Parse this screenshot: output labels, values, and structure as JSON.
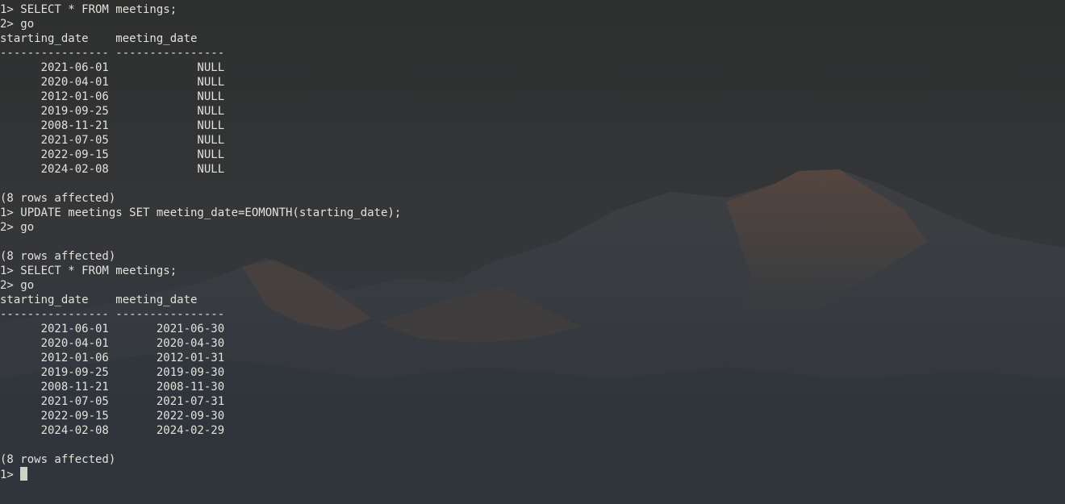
{
  "terminal": {
    "lines": [
      "1> SELECT * FROM meetings;",
      "2> go",
      "starting_date    meeting_date",
      "---------------- ----------------",
      "      2021-06-01             NULL",
      "      2020-04-01             NULL",
      "      2012-01-06             NULL",
      "      2019-09-25             NULL",
      "      2008-11-21             NULL",
      "      2021-07-05             NULL",
      "      2022-09-15             NULL",
      "      2024-02-08             NULL",
      "",
      "(8 rows affected)",
      "1> UPDATE meetings SET meeting_date=EOMONTH(starting_date);",
      "2> go",
      "",
      "(8 rows affected)",
      "1> SELECT * FROM meetings;",
      "2> go",
      "starting_date    meeting_date",
      "---------------- ----------------",
      "      2021-06-01       2021-06-30",
      "      2020-04-01       2020-04-30",
      "      2012-01-06       2012-01-31",
      "      2019-09-25       2019-09-30",
      "      2008-11-21       2008-11-30",
      "      2021-07-05       2021-07-31",
      "      2022-09-15       2022-09-30",
      "      2024-02-08       2024-02-29",
      "",
      "(8 rows affected)"
    ],
    "prompt": "1> "
  },
  "colors": {
    "text": "#e2e2da",
    "cursor": "#c8d5c2",
    "background": "#323436"
  }
}
